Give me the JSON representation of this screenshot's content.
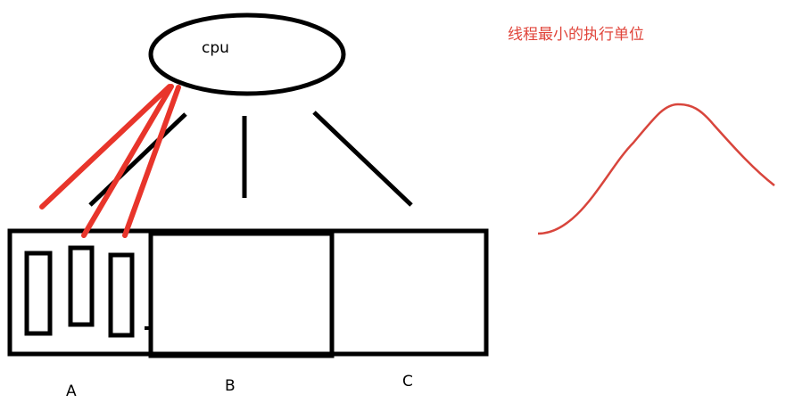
{
  "cpu": {
    "label": "cpu"
  },
  "regions": [
    {
      "id": "A",
      "label": "A"
    },
    {
      "id": "B",
      "label": "B"
    },
    {
      "id": "C",
      "label": "C"
    }
  ],
  "note": {
    "text": "线程最小的执行单位"
  },
  "colors": {
    "ink": "#000000",
    "thread_link": "#e8352b",
    "note": "#e0443a",
    "curve": "#d8453c"
  }
}
